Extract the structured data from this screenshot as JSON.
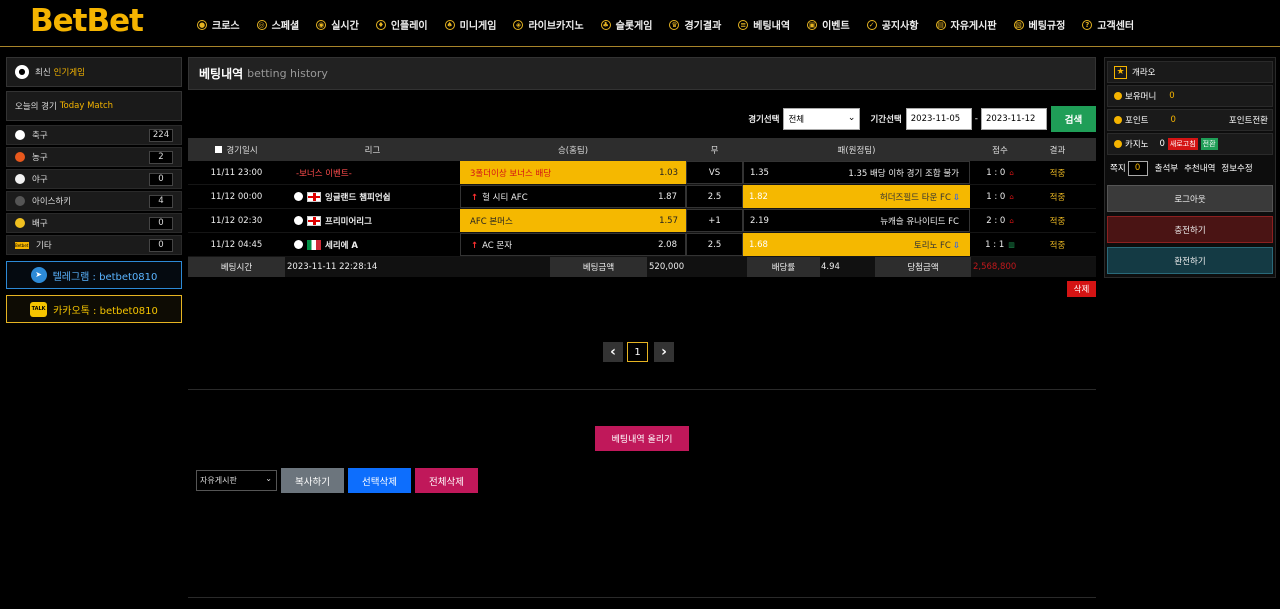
{
  "logo": "BetBet",
  "nav": [
    {
      "icon": "soccer-icon",
      "label": "크로스"
    },
    {
      "icon": "ball-icon",
      "label": "스페셜"
    },
    {
      "icon": "live-icon",
      "label": "실시간"
    },
    {
      "icon": "run-icon",
      "label": "인플레이"
    },
    {
      "icon": "joystick-icon",
      "label": "미니게임"
    },
    {
      "icon": "chip-icon",
      "label": "라이브카지노"
    },
    {
      "icon": "slot-icon",
      "label": "슬롯게임"
    },
    {
      "icon": "trophy-icon",
      "label": "경기결과"
    },
    {
      "icon": "list-icon",
      "label": "베팅내역"
    },
    {
      "icon": "gift-icon",
      "label": "이벤트"
    },
    {
      "icon": "check-icon",
      "label": "공지사항"
    },
    {
      "icon": "board-icon",
      "label": "자유게시판"
    },
    {
      "icon": "rules-icon",
      "label": "베팅규정"
    },
    {
      "icon": "help-icon",
      "label": "고객센터"
    }
  ],
  "left": {
    "latest": {
      "a": "최신",
      "b": "인기게임"
    },
    "today": {
      "a": "오늘의 경기",
      "b": "Today Match"
    },
    "sports": [
      {
        "label": "축구",
        "count": "224",
        "color": "#ffffff"
      },
      {
        "label": "농구",
        "count": "2",
        "color": "#e8581c"
      },
      {
        "label": "야구",
        "count": "0",
        "color": "#f2f2f2"
      },
      {
        "label": "아이스하키",
        "count": "4",
        "color": "#555555"
      },
      {
        "label": "배구",
        "count": "0",
        "color": "#f0c020"
      },
      {
        "label": "기타",
        "count": "0",
        "color": "#f5b400"
      }
    ],
    "telegram": "텔레그램 : betbet0810",
    "kakao": "카카오톡 : betbet0810",
    "bet_badge": "Betbet",
    "talk_badge": "TALK"
  },
  "main": {
    "title": "베팅내역",
    "subtitle": "betting history",
    "filter": {
      "game_label": "경기선택",
      "game_value": "전체",
      "period_label": "기간선택",
      "from": "2023-11-05",
      "dash": "-",
      "to": "2023-11-12",
      "search": "검색"
    },
    "headers": [
      "경기일시",
      "리그",
      "승(홈팀)",
      "무",
      "패(원정팀)",
      "점수",
      "결과"
    ],
    "rows": [
      {
        "date": "11/11 23:00",
        "league": "-보너스 이벤트-",
        "home": "3폴더이상 보너스 배당",
        "home_odds": "1.03",
        "draw": "VS",
        "away_odds": "1.35",
        "away": "1.35 배당 이하 경기 조합 불가",
        "score": "1 : 0",
        "result": "적중",
        "home_yellow": true,
        "away_yellow": false,
        "bonus": true
      },
      {
        "date": "11/12 00:00",
        "league": "잉글랜드 챔피언쉽",
        "home": "헐 시티 AFC",
        "home_odds": "1.87",
        "draw": "2.5",
        "away_odds": "1.82",
        "away": "허더즈필드 타운 FC",
        "score": "1 : 0",
        "result": "적중",
        "home_yellow": false,
        "away_yellow": true,
        "flag": "eng"
      },
      {
        "date": "11/12 02:30",
        "league": "프리미어리그",
        "home": "AFC 본머스",
        "home_odds": "1.57",
        "draw": "+1",
        "away_odds": "2.19",
        "away": "뉴캐슬 유나이티드 FC",
        "score": "2 : 0",
        "result": "적중",
        "home_yellow": true,
        "away_yellow": false,
        "flag": "eng"
      },
      {
        "date": "11/12 04:45",
        "league": "세리에 A",
        "home": "AC 몬자",
        "home_odds": "2.08",
        "draw": "2.5",
        "away_odds": "1.68",
        "away": "토리노 FC",
        "score": "1 : 1",
        "result": "적중",
        "home_yellow": false,
        "away_yellow": true,
        "flag": "ita"
      }
    ],
    "footer": {
      "time_label": "베팅시간",
      "time": "2023-11-11 22:28:14",
      "amount_label": "베팅금액",
      "amount": "520,000",
      "odds_label": "배당률",
      "odds": "4.94",
      "win_label": "당첨금액",
      "win": "2,568,800"
    },
    "delete": "삭제",
    "pagination": {
      "prev": "‹",
      "page": "1",
      "next": "›"
    },
    "upload": "베팅내역 올리기",
    "board_select": "자유게시판",
    "copy": "복사하기",
    "select_delete": "선택삭제",
    "all_delete": "전체삭제"
  },
  "right": {
    "user": "개라오",
    "money_label": "보유머니",
    "money": "0",
    "point_label": "포인트",
    "point": "0",
    "point_convert": "포인트전환",
    "casino_label": "카지노",
    "casino": "0",
    "refresh": "새로고침",
    "convert": "전환",
    "memo_label": "쪽지",
    "memo": "0",
    "attend": "출석부",
    "recommend": "추천내역",
    "info": "정보수정",
    "logout": "로그아웃",
    "deposit": "충전하기",
    "withdraw": "환전하기"
  },
  "colors": {
    "accent": "#f5b400",
    "green": "#1f9e57",
    "blue": "#0d6efd",
    "pink": "#c0185a"
  }
}
